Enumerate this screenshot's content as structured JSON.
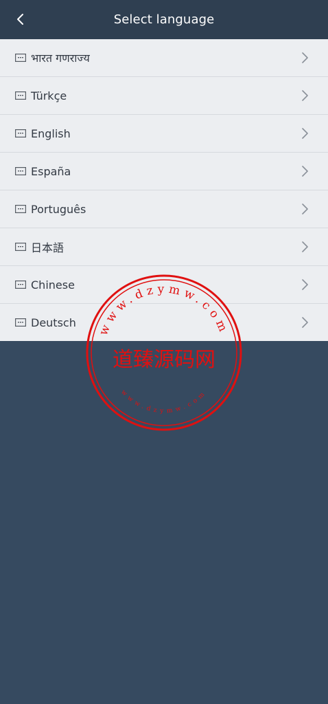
{
  "header": {
    "title": "Select language",
    "back_icon": "chevron-left-icon"
  },
  "languages": [
    {
      "label": "भारत गणराज्य",
      "icon": "keyboard-icon"
    },
    {
      "label": "Türkçe",
      "icon": "keyboard-icon"
    },
    {
      "label": "English",
      "icon": "keyboard-icon"
    },
    {
      "label": "España",
      "icon": "keyboard-icon"
    },
    {
      "label": "Português",
      "icon": "keyboard-icon"
    },
    {
      "label": "日本語",
      "icon": "keyboard-icon"
    },
    {
      "label": "Chinese",
      "icon": "keyboard-icon"
    },
    {
      "label": "Deutsch",
      "icon": "keyboard-icon"
    }
  ],
  "watermark": {
    "top_text": "www.dzymw.com",
    "center_text": "道臻源码网",
    "bottom_text": "www.dzymw.com",
    "color": "#e01010"
  },
  "colors": {
    "header_bg": "#2f3f51",
    "page_bg": "#364a60",
    "list_bg": "#eceef1"
  }
}
